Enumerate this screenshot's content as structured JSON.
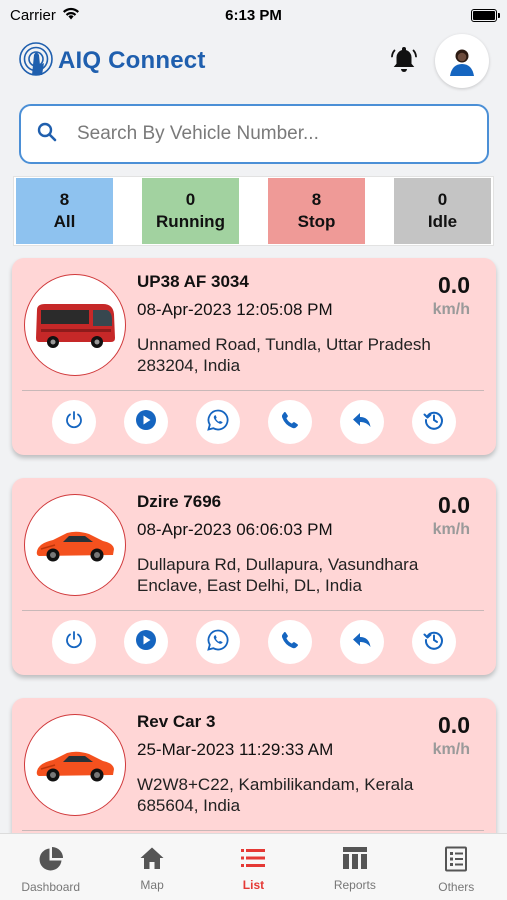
{
  "status_bar": {
    "carrier": "Carrier",
    "time": "6:13 PM"
  },
  "header": {
    "title": "AIQ Connect"
  },
  "search": {
    "placeholder": "Search By Vehicle Number..."
  },
  "filters": [
    {
      "count": "8",
      "label": "All",
      "color": "#8ec2ef"
    },
    {
      "count": "0",
      "label": "Running",
      "color": "#a2d2a0"
    },
    {
      "count": "8",
      "label": "Stop",
      "color": "#ef9a97"
    },
    {
      "count": "0",
      "label": "Idle",
      "color": "#c4c4c4"
    }
  ],
  "vehicles": [
    {
      "name": "UP38 AF 3034",
      "time": "08-Apr-2023 12:05:08 PM",
      "address": "Unnamed Road, Tundla, Uttar Pradesh 283204, India",
      "speed": "0.0",
      "unit": "km/h",
      "icon": "bus-icon"
    },
    {
      "name": "Dzire 7696",
      "time": "08-Apr-2023 06:06:03 PM",
      "address": "Dullapura Rd, Dullapura,  Vasundhara Enclave,  East Delhi,  DL, India",
      "speed": "0.0",
      "unit": "km/h",
      "icon": "car-icon"
    },
    {
      "name": "Rev Car 3",
      "time": "25-Mar-2023 11:29:33 AM",
      "address": "W2W8+C22, Kambilikandam, Kerala 685604, India",
      "speed": "0.0",
      "unit": "km/h",
      "icon": "car-icon"
    }
  ],
  "tabs": [
    {
      "label": "Dashboard",
      "icon": "pie-chart-icon"
    },
    {
      "label": "Map",
      "icon": "home-icon"
    },
    {
      "label": "List",
      "icon": "list-icon",
      "active": true
    },
    {
      "label": "Reports",
      "icon": "table-icon"
    },
    {
      "label": "Others",
      "icon": "document-icon"
    }
  ],
  "colors": {
    "accent": "#1f5fae",
    "card_bg": "#ffd6d6",
    "active_tab": "#e53935",
    "action_icon": "#1565c0"
  }
}
